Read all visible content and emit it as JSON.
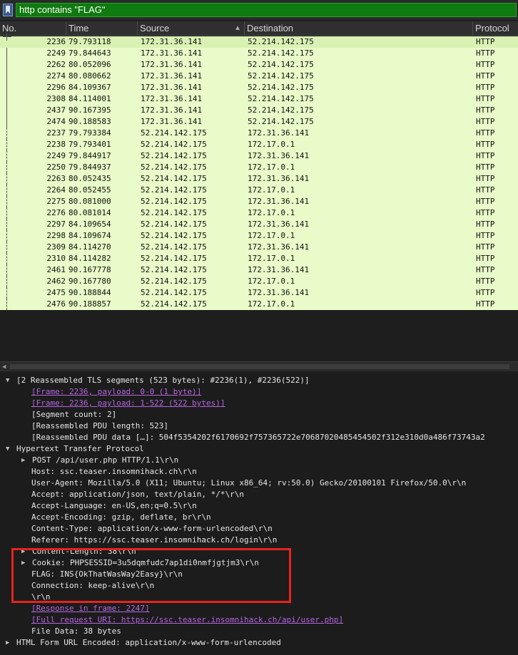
{
  "filter": {
    "value": "http contains \"FLAG\"",
    "icon": "bookmark-icon"
  },
  "columns": [
    "No.",
    "Time",
    "Source",
    "Destination",
    "Protocol"
  ],
  "packets": [
    {
      "no": "2236",
      "time": "79.793118",
      "src": "172.31.36.141",
      "dst": "52.214.142.175",
      "proto": "HTTP"
    },
    {
      "no": "2249",
      "time": "79.844643",
      "src": "172.31.36.141",
      "dst": "52.214.142.175",
      "proto": "HTTP"
    },
    {
      "no": "2262",
      "time": "80.052096",
      "src": "172.31.36.141",
      "dst": "52.214.142.175",
      "proto": "HTTP"
    },
    {
      "no": "2274",
      "time": "80.080662",
      "src": "172.31.36.141",
      "dst": "52.214.142.175",
      "proto": "HTTP"
    },
    {
      "no": "2296",
      "time": "84.109367",
      "src": "172.31.36.141",
      "dst": "52.214.142.175",
      "proto": "HTTP"
    },
    {
      "no": "2308",
      "time": "84.114001",
      "src": "172.31.36.141",
      "dst": "52.214.142.175",
      "proto": "HTTP"
    },
    {
      "no": "2437",
      "time": "90.167395",
      "src": "172.31.36.141",
      "dst": "52.214.142.175",
      "proto": "HTTP"
    },
    {
      "no": "2474",
      "time": "90.188583",
      "src": "172.31.36.141",
      "dst": "52.214.142.175",
      "proto": "HTTP"
    },
    {
      "no": "2237",
      "time": "79.793384",
      "src": "52.214.142.175",
      "dst": "172.31.36.141",
      "proto": "HTTP"
    },
    {
      "no": "2238",
      "time": "79.793401",
      "src": "52.214.142.175",
      "dst": "172.17.0.1",
      "proto": "HTTP"
    },
    {
      "no": "2249",
      "time": "79.844917",
      "src": "52.214.142.175",
      "dst": "172.31.36.141",
      "proto": "HTTP"
    },
    {
      "no": "2250",
      "time": "79.844937",
      "src": "52.214.142.175",
      "dst": "172.17.0.1",
      "proto": "HTTP"
    },
    {
      "no": "2263",
      "time": "80.052435",
      "src": "52.214.142.175",
      "dst": "172.31.36.141",
      "proto": "HTTP"
    },
    {
      "no": "2264",
      "time": "80.052455",
      "src": "52.214.142.175",
      "dst": "172.17.0.1",
      "proto": "HTTP"
    },
    {
      "no": "2275",
      "time": "80.081000",
      "src": "52.214.142.175",
      "dst": "172.31.36.141",
      "proto": "HTTP"
    },
    {
      "no": "2276",
      "time": "80.081014",
      "src": "52.214.142.175",
      "dst": "172.17.0.1",
      "proto": "HTTP"
    },
    {
      "no": "2297",
      "time": "84.109654",
      "src": "52.214.142.175",
      "dst": "172.31.36.141",
      "proto": "HTTP"
    },
    {
      "no": "2298",
      "time": "84.109674",
      "src": "52.214.142.175",
      "dst": "172.17.0.1",
      "proto": "HTTP"
    },
    {
      "no": "2309",
      "time": "84.114270",
      "src": "52.214.142.175",
      "dst": "172.31.36.141",
      "proto": "HTTP"
    },
    {
      "no": "2310",
      "time": "84.114282",
      "src": "52.214.142.175",
      "dst": "172.17.0.1",
      "proto": "HTTP"
    },
    {
      "no": "2461",
      "time": "90.167778",
      "src": "52.214.142.175",
      "dst": "172.31.36.141",
      "proto": "HTTP"
    },
    {
      "no": "2462",
      "time": "90.167780",
      "src": "52.214.142.175",
      "dst": "172.17.0.1",
      "proto": "HTTP"
    },
    {
      "no": "2475",
      "time": "90.188844",
      "src": "52.214.142.175",
      "dst": "172.31.36.141",
      "proto": "HTTP"
    },
    {
      "no": "2476",
      "time": "90.188857",
      "src": "52.214.142.175",
      "dst": "172.17.0.1",
      "proto": "HTTP"
    }
  ],
  "details": [
    {
      "text": "[2 Reassembled TLS segments (523 bytes): #2236(1), #2236(522)]",
      "expander": "expanded",
      "type": "text"
    },
    {
      "text": "[Frame: 2236, payload: 0-0 (1 byte)]",
      "type": "link"
    },
    {
      "text": "[Frame: 2236, payload: 1-522 (522 bytes)]",
      "type": "link"
    },
    {
      "text": "[Segment count: 2]",
      "type": "text"
    },
    {
      "text": "[Reassembled PDU length: 523]",
      "type": "text"
    },
    {
      "text": "[Reassembled PDU data […]: 504f5354202f6170692f757365722e70687020485454502f312e310d0a486f73743a2",
      "type": "text"
    },
    {
      "text": "Hypertext Transfer Protocol",
      "expander": "expanded",
      "type": "text"
    },
    {
      "text": "POST /api/user.php HTTP/1.1\\r\\n",
      "expander": "collapsed",
      "type": "text"
    },
    {
      "text": "Host: ssc.teaser.insomnihack.ch\\r\\n",
      "type": "text"
    },
    {
      "text": "User-Agent: Mozilla/5.0 (X11; Ubuntu; Linux x86_64; rv:50.0) Gecko/20100101 Firefox/50.0\\r\\n",
      "type": "text"
    },
    {
      "text": "Accept: application/json, text/plain, */*\\r\\n",
      "type": "text"
    },
    {
      "text": "Accept-Language: en-US,en;q=0.5\\r\\n",
      "type": "text"
    },
    {
      "text": "Accept-Encoding: gzip, deflate, br\\r\\n",
      "type": "text"
    },
    {
      "text": "Content-Type: application/x-www-form-urlencoded\\r\\n",
      "type": "text"
    },
    {
      "text": "Referer: https://ssc.teaser.insomnihack.ch/login\\r\\n",
      "type": "text"
    },
    {
      "text": "Content-Length: 38\\r\\n",
      "expander": "collapsed",
      "type": "text"
    },
    {
      "text": "Cookie: PHPSESSID=3u5dqmfudc7ap1di0nmfjgtjm3\\r\\n",
      "expander": "collapsed",
      "type": "text"
    },
    {
      "text": "FLAG: INS{OkThatWasWay2Easy}\\r\\n",
      "type": "text"
    },
    {
      "text": "Connection: keep-alive\\r\\n",
      "type": "text"
    },
    {
      "text": "\\r\\n",
      "type": "text"
    },
    {
      "text": "[Response in frame: 2247]",
      "type": "link"
    },
    {
      "text": "[Full request URI: https://ssc.teaser.insomnihack.ch/api/user.php]",
      "type": "link"
    },
    {
      "text": "File Data: 38 bytes",
      "type": "text"
    },
    {
      "text": "HTML Form URL Encoded: application/x-www-form-urlencoded",
      "expander": "collapsed",
      "type": "text"
    }
  ],
  "colors": {
    "row_bg": "#e8fbc8",
    "filter_bg": "#0f7a0f",
    "link": "#b565e0",
    "highlight": "#e8231d"
  }
}
